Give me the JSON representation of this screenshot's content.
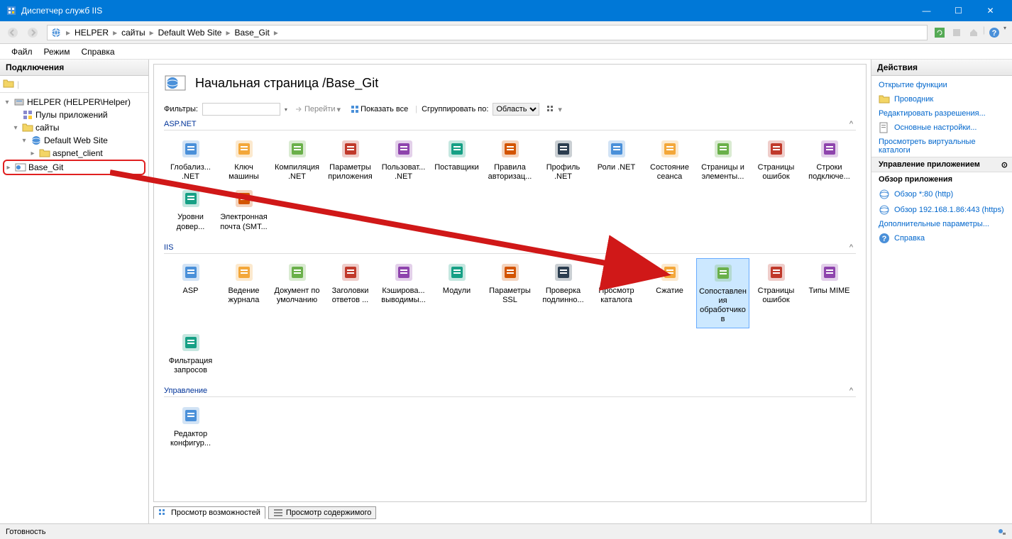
{
  "window": {
    "title": "Диспетчер служб IIS",
    "minimize": "—",
    "maximize": "☐",
    "close": "✕"
  },
  "breadcrumb": {
    "items": [
      "HELPER",
      "сайты",
      "Default Web Site",
      "Base_Git"
    ]
  },
  "menu": {
    "file": "Файл",
    "mode": "Режим",
    "help": "Справка"
  },
  "leftpanel": {
    "header": "Подключения"
  },
  "tree": {
    "root": "HELPER (HELPER\\Helper)",
    "apppools": "Пулы приложений",
    "sites": "сайты",
    "defaultsite": "Default Web Site",
    "aspnetclient": "aspnet_client",
    "basegit": "Base_Git"
  },
  "center": {
    "title": "Начальная страница /Base_Git",
    "filter_label": "Фильтры:",
    "go_label": "Перейти",
    "showall_label": "Показать все",
    "groupby_label": "Сгруппировать по:",
    "groupby_value": "Область"
  },
  "sections": {
    "aspnet": "ASP.NET",
    "iis": "IIS",
    "management": "Управление"
  },
  "features_aspnet": [
    {
      "label": "Глобализ... .NET"
    },
    {
      "label": "Ключ машины"
    },
    {
      "label": "Компиляция .NET"
    },
    {
      "label": "Параметры приложения"
    },
    {
      "label": "Пользоват... .NET"
    },
    {
      "label": "Поставщики"
    },
    {
      "label": "Правила авторизац..."
    },
    {
      "label": "Профиль .NET"
    },
    {
      "label": "Роли .NET"
    },
    {
      "label": "Состояние сеанса"
    },
    {
      "label": "Страницы и элементы..."
    },
    {
      "label": "Страницы ошибок"
    },
    {
      "label": "Строки подключе..."
    },
    {
      "label": "Уровни довер..."
    },
    {
      "label": "Электронная почта (SMT..."
    }
  ],
  "features_iis": [
    {
      "label": "ASP"
    },
    {
      "label": "Ведение журнала"
    },
    {
      "label": "Документ по умолчанию"
    },
    {
      "label": "Заголовки ответов ..."
    },
    {
      "label": "Кэширова... выводимы..."
    },
    {
      "label": "Модули"
    },
    {
      "label": "Параметры SSL"
    },
    {
      "label": "Проверка подлинно..."
    },
    {
      "label": "Просмотр каталога"
    },
    {
      "label": "Сжатие"
    },
    {
      "label": "Сопоставления обработчиков",
      "selected": true
    },
    {
      "label": "Страницы ошибок"
    },
    {
      "label": "Типы MIME"
    },
    {
      "label": "Фильтрация запросов"
    }
  ],
  "features_mgmt": [
    {
      "label": "Редактор конфигур..."
    }
  ],
  "bottomtabs": {
    "features": "Просмотр возможностей",
    "content": "Просмотр содержимого"
  },
  "rightpanel": {
    "header": "Действия",
    "open_feature": "Открытие функции",
    "explorer": "Проводник",
    "edit_permissions": "Редактировать разрешения...",
    "basic_settings": "Основные настройки...",
    "view_vdirs": "Просмотреть виртуальные каталоги",
    "app_mgmt_header": "Управление приложением",
    "browse_app_header": "Обзор приложения",
    "browse_http": "Обзор *:80 (http)",
    "browse_https": "Обзор 192.168.1.86:443 (https)",
    "additional_params": "Дополнительные параметры...",
    "help": "Справка"
  },
  "statusbar": {
    "text": "Готовность"
  }
}
